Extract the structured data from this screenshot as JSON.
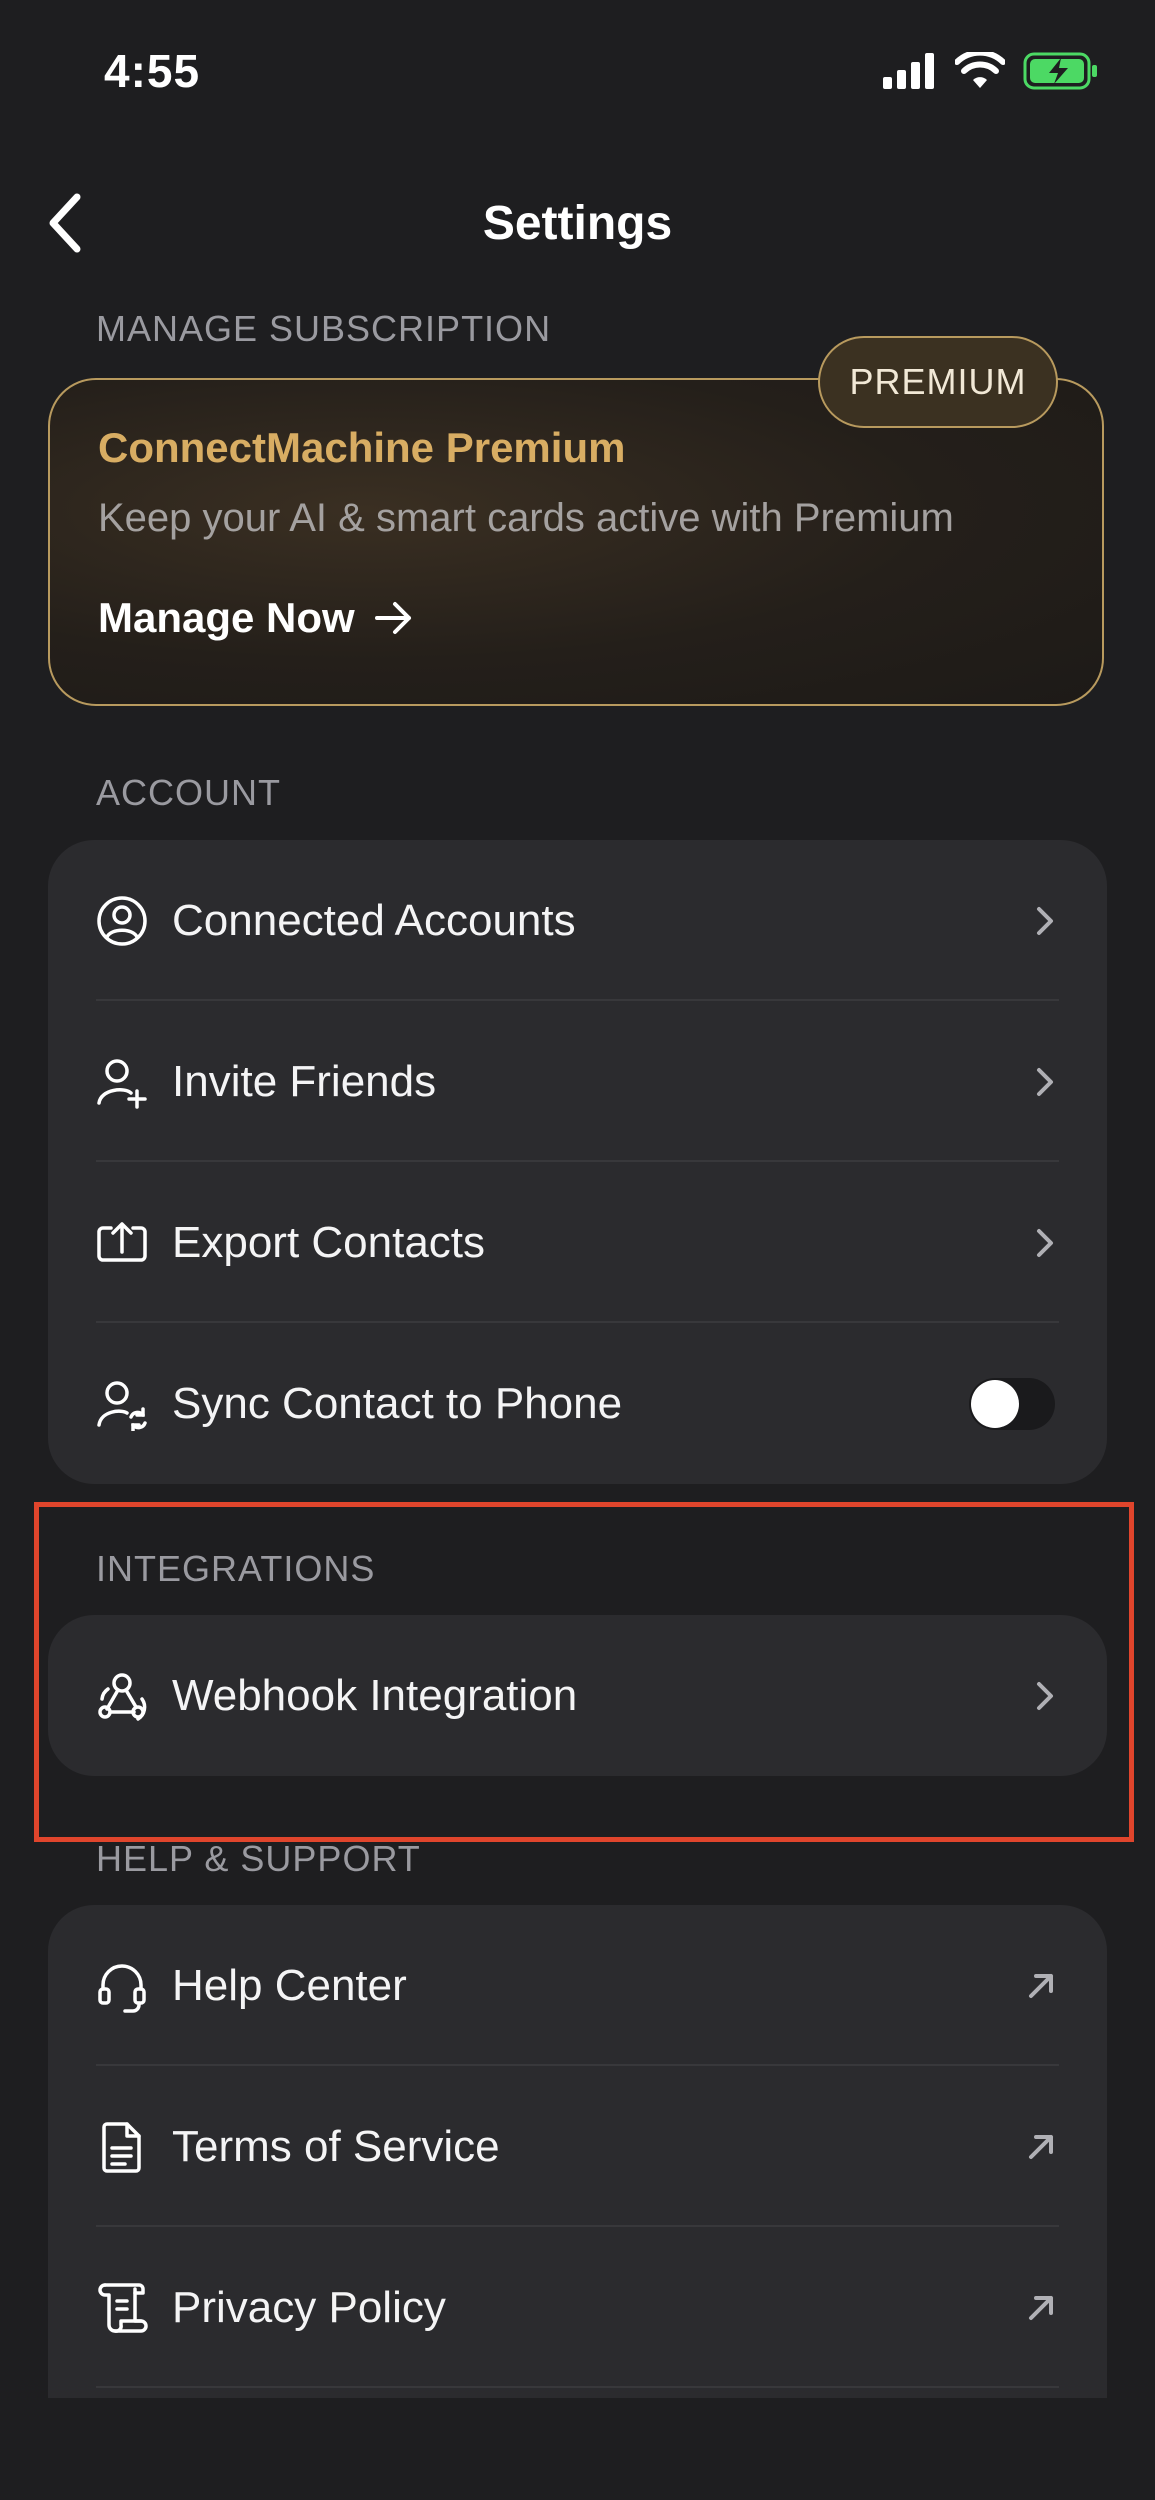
{
  "status": {
    "time": "4:55"
  },
  "nav": {
    "title": "Settings"
  },
  "subscription": {
    "section_label": "MANAGE SUBSCRIPTION",
    "badge": "PREMIUM",
    "title": "ConnectMachine Premium",
    "description": "Keep your AI & smart cards active with Premium",
    "cta": "Manage Now"
  },
  "account": {
    "section_label": "ACCOUNT",
    "items": [
      {
        "label": "Connected Accounts",
        "icon": "user-circle-icon"
      },
      {
        "label": "Invite Friends",
        "icon": "user-plus-icon"
      },
      {
        "label": "Export Contacts",
        "icon": "export-icon"
      },
      {
        "label": "Sync Contact to Phone",
        "icon": "user-sync-icon",
        "toggle": false
      }
    ]
  },
  "integrations": {
    "section_label": "INTEGRATIONS",
    "items": [
      {
        "label": "Webhook Integration",
        "icon": "webhook-icon"
      }
    ]
  },
  "help": {
    "section_label": "HELP & SUPPORT",
    "items": [
      {
        "label": "Help Center",
        "icon": "headset-icon"
      },
      {
        "label": "Terms of Service",
        "icon": "document-icon"
      },
      {
        "label": "Privacy Policy",
        "icon": "scroll-icon"
      }
    ]
  },
  "colors": {
    "accent_gold": "#d8ad63",
    "highlight": "#e0452c",
    "battery": "#4cd964"
  }
}
